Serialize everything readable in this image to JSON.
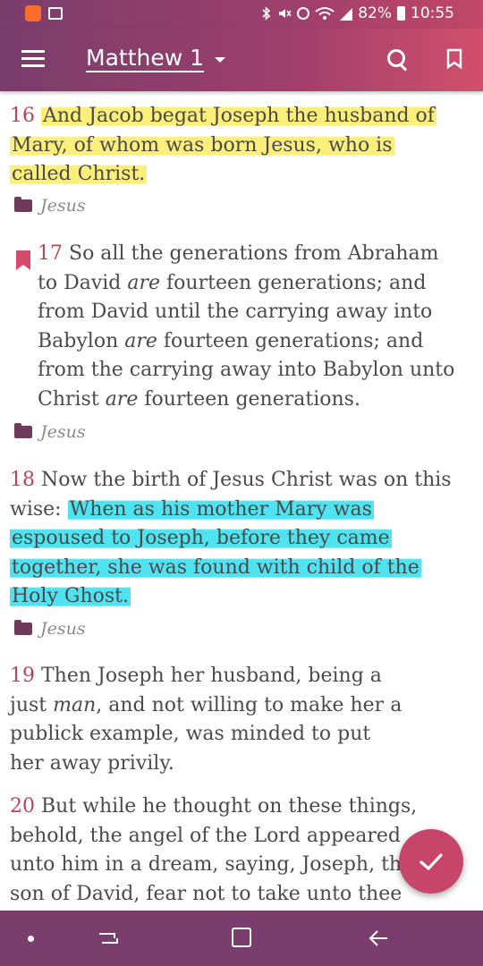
{
  "status_bar": {
    "battery": "82%",
    "time": "10:55"
  },
  "app_bar": {
    "title": "Matthew 1"
  },
  "verses": [
    {
      "number": "16",
      "highlighted_text": "And Jacob begat Joseph the husband of Mary, of whom was born Jesus, who is called Christ.",
      "highlight_color": "#fbef7a",
      "tag": "Jesus"
    },
    {
      "number": "17",
      "bookmarked": true,
      "parts": [
        "So all the generations from Abraham to David ",
        "are",
        " fourteen generations; and from David until the carrying away into Babylon ",
        "are",
        " fourteen generations; and from the carrying away into Babylon unto Christ ",
        "are",
        " fourteen generations."
      ],
      "tag": "Jesus"
    },
    {
      "number": "18",
      "text": "Now the birth of Jesus Christ was on this wise:",
      "highlighted_text": "When as his mother Mary was espoused to Joseph, before they came together, she was found with child of the Holy Ghost.",
      "highlight_color": "#4fe3f1",
      "tag": "Jesus"
    },
    {
      "number": "19",
      "parts": [
        "Then Joseph her husband, being a just ",
        "man",
        ", and not willing to make her a publick example, was minded to put her away privily."
      ]
    },
    {
      "number": "20",
      "text": "But while he thought on these things, behold, the angel of the Lord appeared unto him in a dream, saying, Joseph, thou son of David, fear not to take unto thee Mary"
    }
  ],
  "colors": {
    "accent": "#b5455f",
    "app_bar": "#7a3d6d",
    "fab": "#c8456a"
  },
  "icons": {
    "menu": "menu-icon",
    "search": "search-icon",
    "bookmark": "bookmark-icon",
    "tag": "folder-icon",
    "fab": "check-icon"
  }
}
